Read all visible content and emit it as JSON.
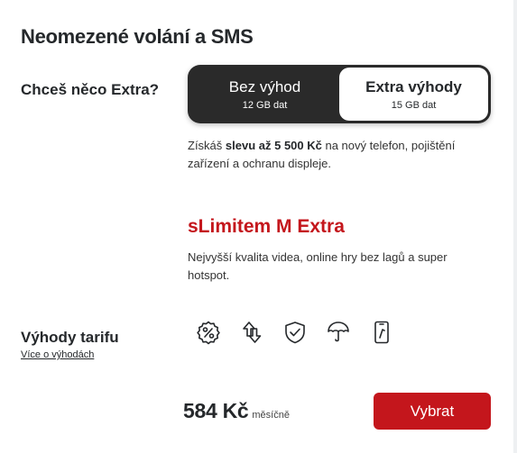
{
  "title": "Neomezené volání a SMS",
  "extra": {
    "question": "Chceš něco Extra?",
    "options": [
      {
        "label": "Bez výhod",
        "data": "12 GB dat",
        "selected": false
      },
      {
        "label": "Extra výhody",
        "data": "15 GB dat",
        "selected": true
      }
    ],
    "desc_prefix": "Získáš ",
    "desc_bold": "slevu až 5 500 Kč",
    "desc_suffix": " na nový telefon, pojištění zařízení a ochranu displeje."
  },
  "plan": {
    "name": "sLimitem M Extra",
    "description": "Nejvyšší kvalita videa, online hry bez lagů a super hotspot."
  },
  "benefits": {
    "title": "Výhody tarifu",
    "link": "Více o výhodách",
    "icons": [
      "discount-badge-icon",
      "data-transfer-icon",
      "shield-check-icon",
      "umbrella-icon",
      "phone-screen-icon"
    ]
  },
  "price": {
    "amount": "584 Kč",
    "period": "měsíčně"
  },
  "cta": {
    "label": "Vybrat"
  },
  "colors": {
    "accent": "#c4161c",
    "toggle_dark": "#2a2a2a",
    "text": "#25282b"
  }
}
